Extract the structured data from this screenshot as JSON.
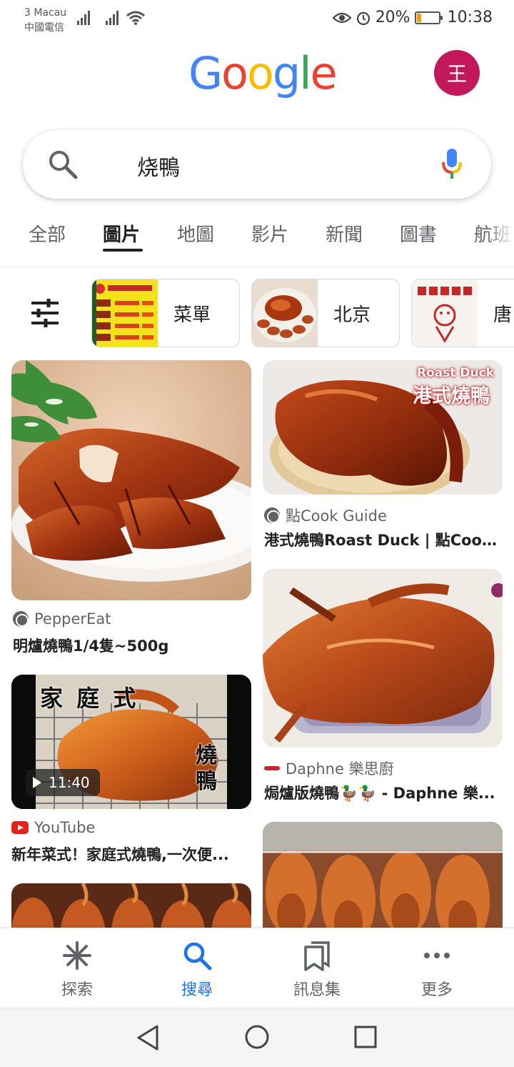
{
  "status_bar": {
    "carrier_line1": "3 Macau",
    "carrier_line2": "中國電信",
    "battery_text": "20%",
    "battery_level": 0.2,
    "time": "10:38"
  },
  "header": {
    "logo_letters": [
      "G",
      "o",
      "o",
      "g",
      "l",
      "e"
    ],
    "logo_colors": [
      "#4285F4",
      "#EA4335",
      "#FBBC05",
      "#4285F4",
      "#34A853",
      "#EA4335"
    ],
    "avatar_initial": "王"
  },
  "search": {
    "query": "烧鴨"
  },
  "tabs": [
    "全部",
    "圖片",
    "地圖",
    "影片",
    "新聞",
    "圖書",
    "航班"
  ],
  "chips": [
    {
      "label": "菜單"
    },
    {
      "label": "北京"
    },
    {
      "label": "唐"
    }
  ],
  "results": [
    {
      "source": "PepperEat",
      "title": "明爐燒鴨1/4隻~500g"
    },
    {
      "source": "點Cook Guide",
      "title": "港式燒鴨Roast Duck | 點Cook ...",
      "overlay_en": "Roast Duck",
      "overlay_zh": "港式燒鴨"
    },
    {
      "source": "YouTube",
      "title": "新年菜式！家庭式燒鴨,一次便...",
      "duration": "11:40",
      "overlay_zh": "家 庭 式",
      "overlay_side": "燒鴨"
    },
    {
      "source": "Daphne 樂思廚",
      "title": "焗爐版燒鴨🦆🦆 - Daphne 樂..."
    }
  ],
  "bottom_nav": [
    {
      "label": "探索"
    },
    {
      "label": "搜尋"
    },
    {
      "label": "訊息集"
    },
    {
      "label": "更多"
    }
  ],
  "colors": {
    "accent": "#1a73e8",
    "avatar_bg": "#c2185b",
    "duck_dark": "#7a1d0e",
    "duck_mid": "#b8441a",
    "duck_light": "#e08030"
  }
}
